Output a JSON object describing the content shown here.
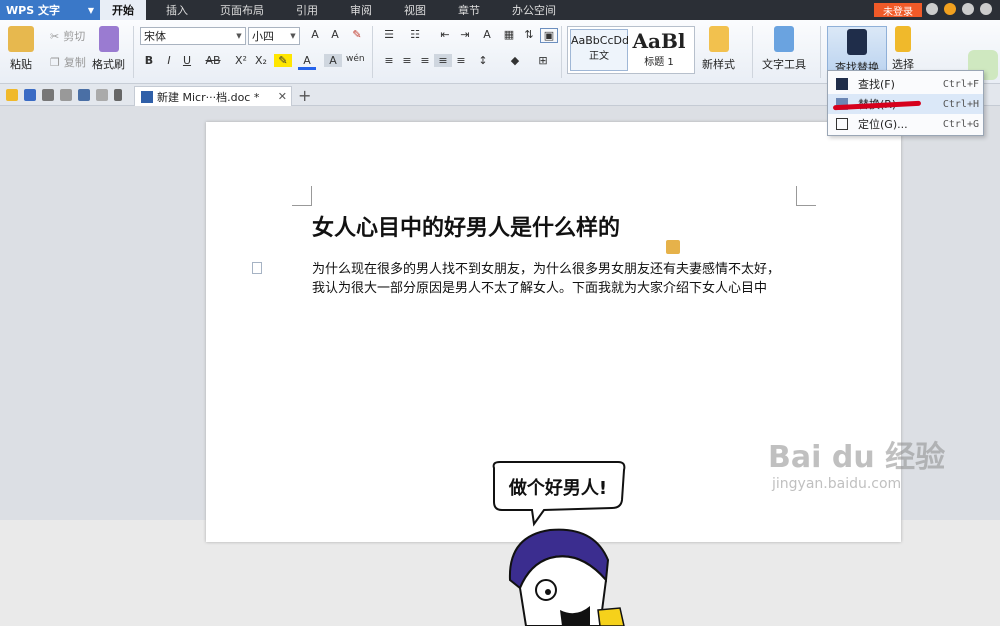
{
  "titlebar": {
    "app_name": "WPS 文字",
    "tabs": [
      "开始",
      "插入",
      "页面布局",
      "引用",
      "审阅",
      "视图",
      "章节",
      "办公空间"
    ],
    "login": "未登录"
  },
  "ribbon": {
    "paste": "粘贴",
    "cut": "剪切",
    "copy": "复制",
    "format_painter": "格式刷",
    "font_name": "宋体",
    "font_size": "小四",
    "styles": [
      {
        "preview": "AaBbCcDd",
        "name": "正文"
      },
      {
        "preview": "AaBl",
        "name": "标题 1"
      }
    ],
    "new_style": "新样式",
    "text_tools": "文字工具",
    "find_replace": "查找替换",
    "select": "选择",
    "format_letters": [
      "B",
      "I",
      "U",
      "AB",
      "X²",
      "X₂",
      "A",
      "A"
    ]
  },
  "tabbar": {
    "doc_tab": "新建 Micr···档.doc *"
  },
  "document": {
    "title": "女人心目中的好男人是什么样的",
    "paragraph_line1": "为什么现在很多的男人找不到女朋友，为什么很多男女朋友还有夫妻感情不太好，",
    "paragraph_line2": "我认为很大一部分原因是男人不太了解女人。下面我就为大家介绍下女人心目中",
    "illustration_text": "做个好男人!"
  },
  "dropdown": {
    "items": [
      {
        "label": "查找(F)",
        "shortcut": "Ctrl+F"
      },
      {
        "label": "替换(R)",
        "shortcut": "Ctrl+H"
      },
      {
        "label": "定位(G)...",
        "shortcut": "Ctrl+G"
      }
    ]
  },
  "watermark": {
    "brand": "Bai du 经验",
    "url": "jingyan.baidu.com"
  },
  "colors": {
    "titlebar": "#2b2f36",
    "accent": "#3a78c8",
    "login": "#f05a28",
    "highlight": "#dbe8f8",
    "annotation_red": "#d6001c"
  }
}
